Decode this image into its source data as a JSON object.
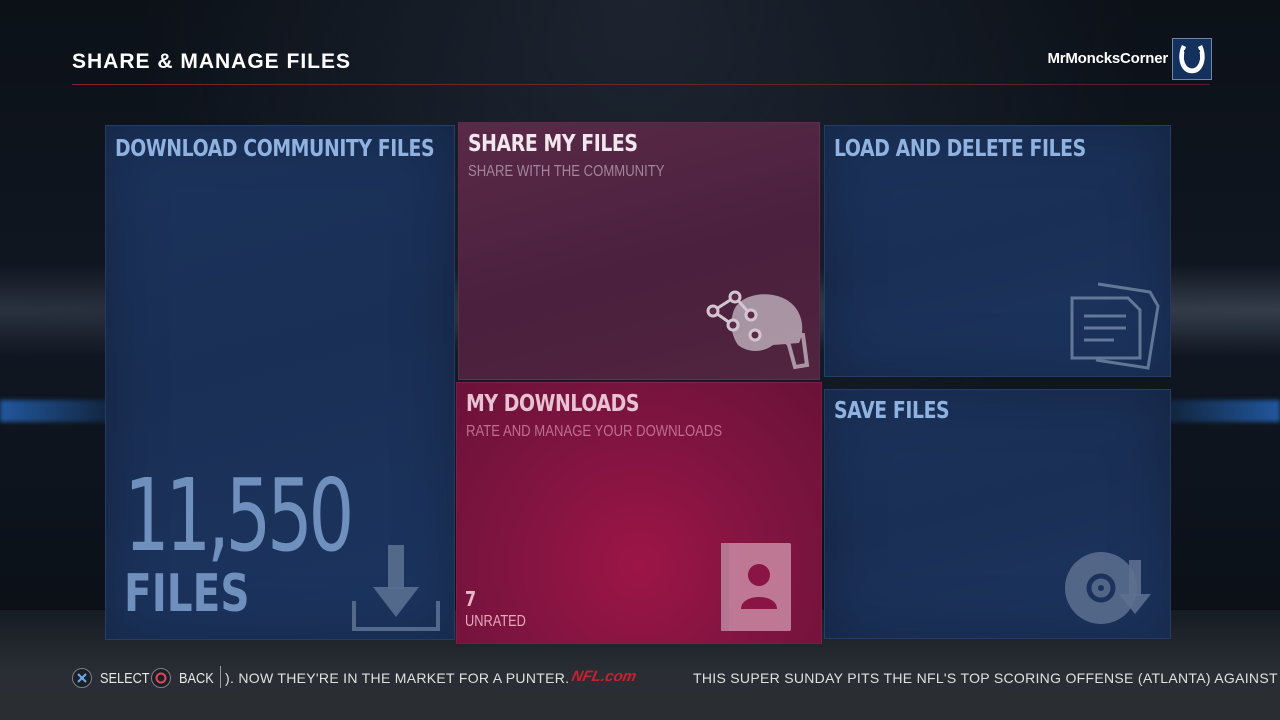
{
  "header": {
    "title": "SHARE & MANAGE FILES",
    "username": "MrMoncksCorner",
    "team_logo_icon": "horseshoe-icon"
  },
  "tiles": {
    "download_community": {
      "title": "DOWNLOAD COMMUNITY FILES",
      "count": "11,550",
      "count_label": "FILES",
      "icon": "download-arrow-icon"
    },
    "share_my_files": {
      "title": "SHARE MY FILES",
      "subtitle": "SHARE WITH THE COMMUNITY",
      "icon": "share-helmet-icon"
    },
    "my_downloads": {
      "title": "MY DOWNLOADS",
      "subtitle": "RATE AND MANAGE YOUR DOWNLOADS",
      "count": "7",
      "count_label": "UNRATED",
      "icon": "profile-book-icon"
    },
    "load_delete": {
      "title": "LOAD AND DELETE FILES",
      "icon": "documents-icon"
    },
    "save_files": {
      "title": "SAVE FILES",
      "icon": "disc-save-icon"
    }
  },
  "footer": {
    "select_label": "SELECT",
    "back_label": "BACK",
    "ticker_left": "). NOW THEY'RE IN THE MARKET FOR A PUNTER.",
    "ticker_brand": "NFL.com",
    "ticker_right": "THIS SUPER SUNDAY PITS THE NFL'S TOP SCORING OFFENSE (ATLANTA) AGAINST THE"
  },
  "colors": {
    "tile_blue": "#1b335c",
    "tile_share": "#5a2a48",
    "tile_downloads": "#8a1443",
    "accent_red": "#c9202f",
    "title_blue": "#8fb2e0"
  }
}
